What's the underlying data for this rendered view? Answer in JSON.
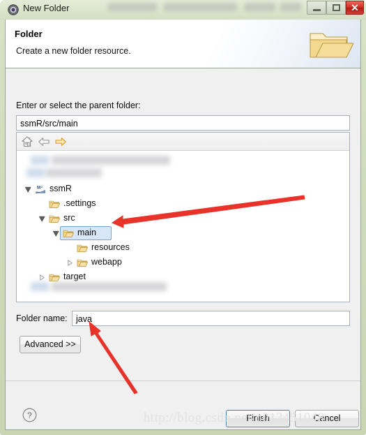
{
  "window": {
    "title": "New Folder",
    "title_icon": "eclipse-wizard-icon",
    "minimize_label": "Minimize",
    "maximize_label": "Maximize",
    "close_label": "✕"
  },
  "banner": {
    "title": "Folder",
    "description": "Create a new folder resource.",
    "icon": "open-folder-icon"
  },
  "content": {
    "parent_label": "Enter or select the parent folder:",
    "parent_value": "ssmR/src/main",
    "folder_name_label": "Folder name:",
    "folder_name_value": "java",
    "advanced_label": "Advanced >>"
  },
  "tree_toolbar": {
    "home_label": "Home",
    "back_label": "Back",
    "forward_label": "Forward"
  },
  "tree": {
    "items": [
      {
        "label": "ssmR",
        "indent": 0,
        "twisty": "expanded",
        "icon": "maven-project-icon",
        "selected": false
      },
      {
        "label": ".settings",
        "indent": 1,
        "twisty": "none",
        "icon": "folder-icon",
        "selected": false
      },
      {
        "label": "src",
        "indent": 1,
        "twisty": "expanded",
        "icon": "folder-icon",
        "selected": false
      },
      {
        "label": "main",
        "indent": 2,
        "twisty": "expanded",
        "icon": "folder-icon",
        "selected": true
      },
      {
        "label": "resources",
        "indent": 3,
        "twisty": "none",
        "icon": "folder-icon",
        "selected": false
      },
      {
        "label": "webapp",
        "indent": 3,
        "twisty": "collapsed",
        "icon": "folder-icon",
        "selected": false
      },
      {
        "label": "target",
        "indent": 1,
        "twisty": "collapsed",
        "icon": "folder-icon",
        "selected": false
      }
    ]
  },
  "footer": {
    "help_label": "?",
    "finish_label": "Finish",
    "cancel_label": "Cancel"
  },
  "watermark": {
    "text": "http://blog.csdn.net/u013451048"
  },
  "colors": {
    "frame": "#cfdcbb",
    "close_button": "#d32e22",
    "selection": "#d7e7f8",
    "selection_border": "#7da2ce",
    "annotation_arrow": "#e8332a",
    "folder_icon": "#f5d68a"
  }
}
